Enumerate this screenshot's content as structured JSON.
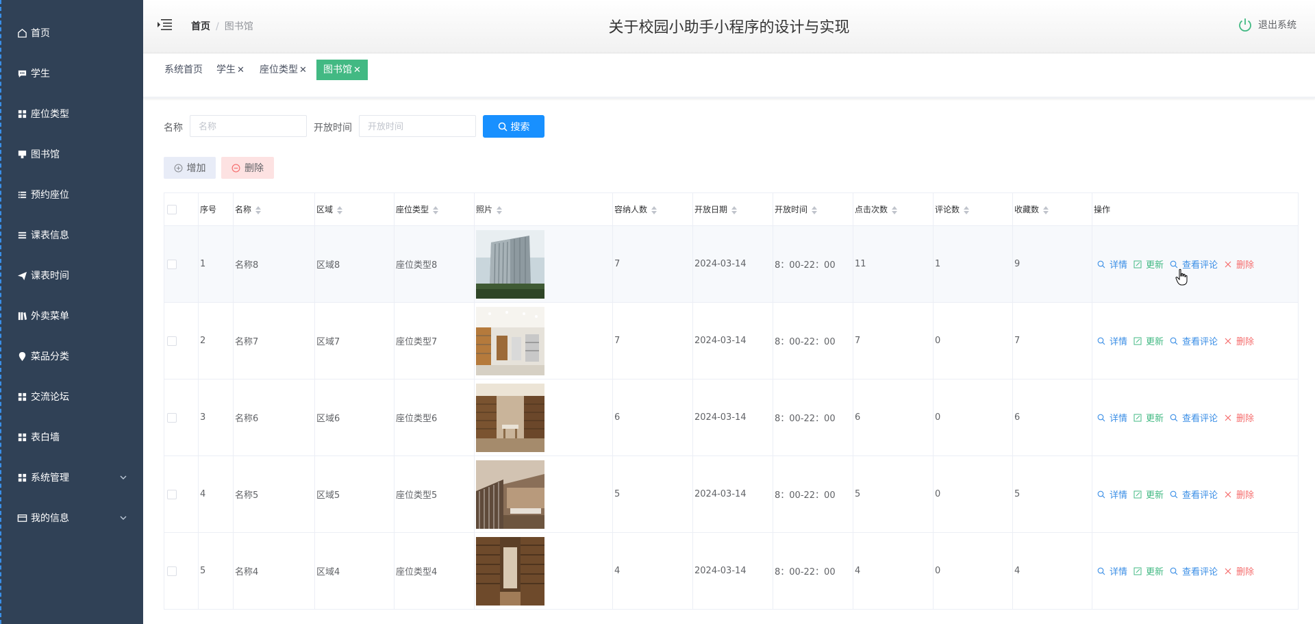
{
  "app": {
    "title": "关于校园小助手小程序的设计与实现",
    "logout_label": "退出系统"
  },
  "breadcrumb": {
    "home": "首页",
    "current": "图书馆"
  },
  "sidebar": {
    "items": [
      {
        "label": "首页",
        "icon": "home-icon"
      },
      {
        "label": "学生",
        "icon": "chat-icon"
      },
      {
        "label": "座位类型",
        "icon": "grid-icon"
      },
      {
        "label": "图书馆",
        "icon": "board-icon"
      },
      {
        "label": "预约座位",
        "icon": "list-icon"
      },
      {
        "label": "课表信息",
        "icon": "menu-icon"
      },
      {
        "label": "课表时间",
        "icon": "send-icon"
      },
      {
        "label": "外卖菜单",
        "icon": "library-icon"
      },
      {
        "label": "菜品分类",
        "icon": "pin-icon"
      },
      {
        "label": "交流论坛",
        "icon": "grid-icon"
      },
      {
        "label": "表白墙",
        "icon": "grid-icon"
      },
      {
        "label": "系统管理",
        "icon": "grid-icon",
        "expandable": true
      },
      {
        "label": "我的信息",
        "icon": "card-icon",
        "expandable": true
      }
    ]
  },
  "tags": [
    {
      "label": "系统首页",
      "closable": false,
      "active": false
    },
    {
      "label": "学生",
      "closable": true,
      "active": false
    },
    {
      "label": "座位类型",
      "closable": true,
      "active": false
    },
    {
      "label": "图书馆",
      "closable": true,
      "active": true
    }
  ],
  "tag_close_glyph": "✕",
  "search": {
    "name_label": "名称",
    "name_placeholder": "名称",
    "name_value": "",
    "time_label": "开放时间",
    "time_placeholder": "开放时间",
    "time_value": "",
    "button_label": "搜索"
  },
  "actions": {
    "add_label": "增加",
    "delete_label": "删除"
  },
  "table": {
    "columns": [
      "",
      "序号",
      "名称",
      "区域",
      "座位类型",
      "照片",
      "容纳人数",
      "开放日期",
      "开放时间",
      "点击次数",
      "评论数",
      "收藏数",
      "操作"
    ],
    "sortable": [
      false,
      false,
      true,
      true,
      true,
      true,
      true,
      true,
      true,
      true,
      true,
      true,
      false
    ],
    "row_ops": {
      "detail": "详情",
      "update": "更新",
      "comments": "查看评论",
      "delete": "删除"
    },
    "rows": [
      {
        "index": "1",
        "name": "名称8",
        "area": "区域8",
        "seat_type": "座位类型8",
        "photo": "building",
        "capacity": "7",
        "open_date": "2024-03-14",
        "open_time": "8：00-22：00",
        "clicks": "11",
        "comments": "1",
        "favorites": "9"
      },
      {
        "index": "2",
        "name": "名称7",
        "area": "区域7",
        "seat_type": "座位类型7",
        "photo": "shelves-bright",
        "capacity": "7",
        "open_date": "2024-03-14",
        "open_time": "8：00-22：00",
        "clicks": "7",
        "comments": "0",
        "favorites": "7"
      },
      {
        "index": "3",
        "name": "名称6",
        "area": "区域6",
        "seat_type": "座位类型6",
        "photo": "reading-room",
        "capacity": "6",
        "open_date": "2024-03-14",
        "open_time": "8：00-22：00",
        "clicks": "6",
        "comments": "0",
        "favorites": "6"
      },
      {
        "index": "4",
        "name": "名称5",
        "area": "区域5",
        "seat_type": "座位类型5",
        "photo": "atrium",
        "capacity": "5",
        "open_date": "2024-03-14",
        "open_time": "8：00-22：00",
        "clicks": "5",
        "comments": "0",
        "favorites": "5"
      },
      {
        "index": "5",
        "name": "名称4",
        "area": "区域4",
        "seat_type": "座位类型4",
        "photo": "tall-shelves",
        "capacity": "4",
        "open_date": "2024-03-14",
        "open_time": "8：00-22：00",
        "clicks": "4",
        "comments": "0",
        "favorites": "4"
      }
    ]
  },
  "colors": {
    "sidebar_bg": "#304156",
    "accent": "#1890ff",
    "active_tag": "#42b983",
    "danger": "#f56c6c"
  }
}
